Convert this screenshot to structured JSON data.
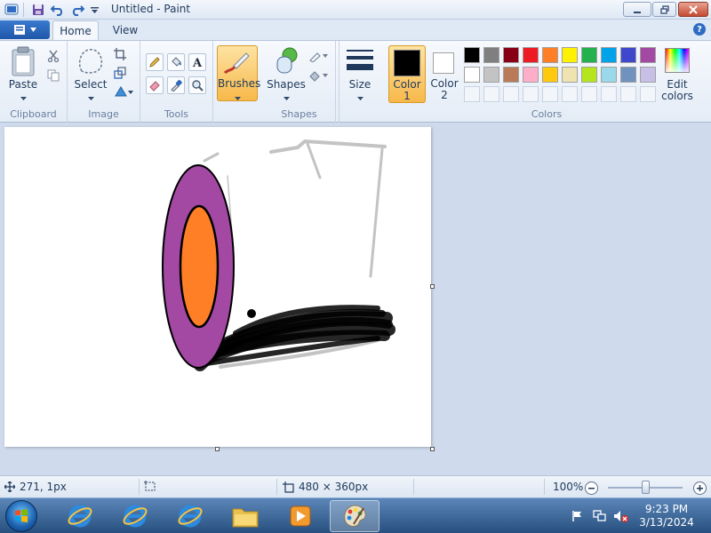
{
  "window": {
    "title": "Untitled - Paint"
  },
  "tabs": [
    {
      "label": "Home",
      "active": true
    },
    {
      "label": "View",
      "active": false
    }
  ],
  "ribbon": {
    "clipboard": {
      "group_label": "Clipboard",
      "paste_label": "Paste"
    },
    "image": {
      "group_label": "Image",
      "select_label": "Select"
    },
    "tools": {
      "group_label": "Tools"
    },
    "brushes": {
      "label": "Brushes"
    },
    "shapes": {
      "group_label": "Shapes",
      "label": "Shapes"
    },
    "size": {
      "label": "Size"
    },
    "colors": {
      "group_label": "Colors",
      "color1_label": "Color",
      "color1_num": "1",
      "color2_label": "Color",
      "color2_num": "2",
      "edit_label": "Edit",
      "edit_label2": "colors",
      "color1": "#000000",
      "color2": "#ffffff",
      "palette_row1": [
        "#000000",
        "#7f7f7f",
        "#880015",
        "#ed1c24",
        "#ff7f27",
        "#fff200",
        "#22b14c",
        "#00a2e8",
        "#3f48cc",
        "#a349a4"
      ],
      "palette_row2": [
        "#ffffff",
        "#c3c3c3",
        "#b97a57",
        "#ffaec9",
        "#ffc90e",
        "#efe4b0",
        "#b5e61d",
        "#99d9ea",
        "#7092be",
        "#c8bfe7"
      ]
    }
  },
  "status": {
    "cursor_pos": "271, 1px",
    "image_size": "480 × 360px",
    "zoom": "100%"
  },
  "taskbar": {
    "time": "9:23 PM",
    "date": "3/13/2024"
  },
  "drawing_colors": {
    "purple": "#a349a4",
    "orange": "#ff7f27",
    "gray": "#c3c3c3",
    "black": "#000000"
  }
}
